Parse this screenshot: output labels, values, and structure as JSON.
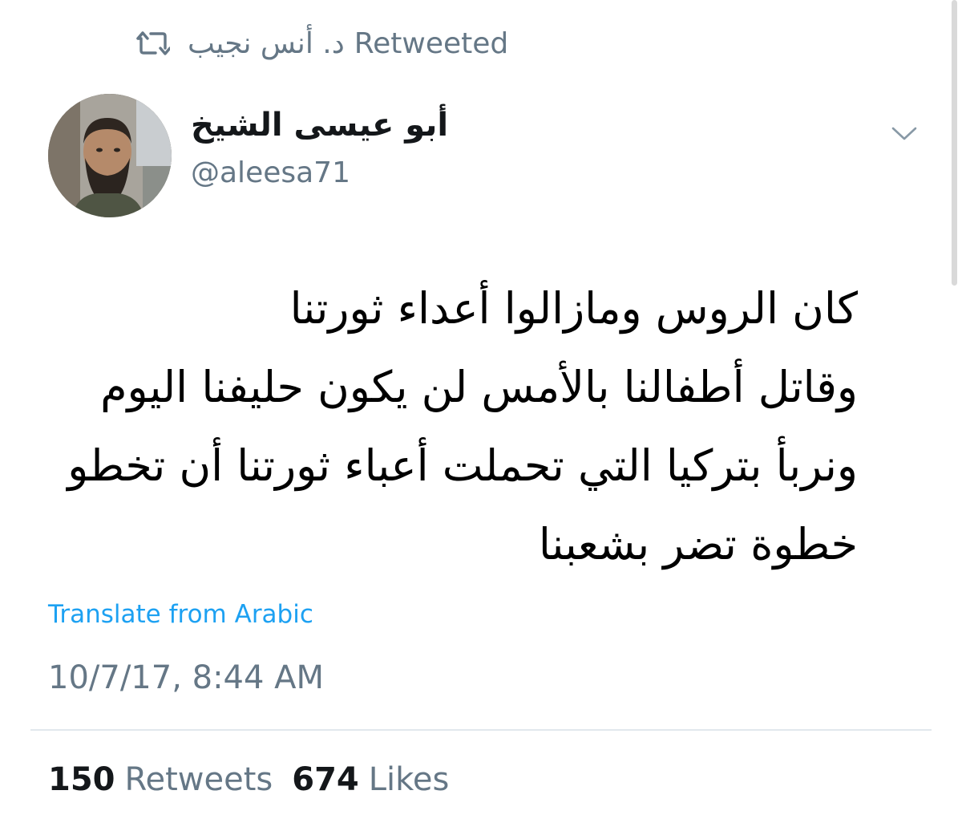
{
  "retweet_banner": {
    "icon": "retweet-icon",
    "retweeter_name": "د. أنس نجيب",
    "label": "Retweeted"
  },
  "author": {
    "avatar": "profile-photo",
    "display_name": "أبو عيسى الشيخ",
    "handle": "@aleesa71"
  },
  "menu": {
    "icon": "chevron-down-icon"
  },
  "tweet": {
    "lines": [
      "كان الروس ومازالوا  أعداء ثورتنا",
      "وقاتل أطفالنا بالأمس لن يكون حليفنا اليوم",
      "ونربأ بتركيا التي تحملت أعباء ثورتنا أن تخطو",
      "خطوة تضر بشعبنا"
    ],
    "translate_link": "Translate from Arabic",
    "timestamp": "10/7/17, 8:44 AM"
  },
  "stats": {
    "retweets_count": "150",
    "retweets_label": "Retweets",
    "likes_count": "674",
    "likes_label": "Likes"
  },
  "colors": {
    "secondary_text": "#657786",
    "link": "#1da1f2",
    "divider": "#e1e8ed"
  }
}
